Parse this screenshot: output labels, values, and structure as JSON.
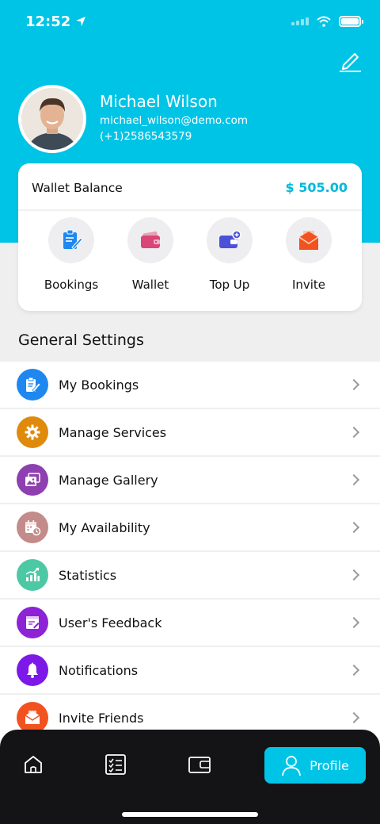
{
  "status_bar": {
    "time": "12:52"
  },
  "profile": {
    "name": "Michael Wilson",
    "email": "michael_wilson@demo.com",
    "phone": "(+1)2586543579"
  },
  "wallet": {
    "label": "Wallet Balance",
    "amount": "$ 505.00"
  },
  "quick_actions": [
    {
      "label": "Bookings",
      "icon": "clipboard-edit-icon"
    },
    {
      "label": "Wallet",
      "icon": "wallet-icon"
    },
    {
      "label": "Top Up",
      "icon": "wallet-plus-icon"
    },
    {
      "label": "Invite",
      "icon": "envelope-icon"
    }
  ],
  "settings": {
    "title": "General Settings",
    "items": [
      {
        "label": "My Bookings",
        "icon": "clipboard-edit-icon",
        "color": "#1e88f0"
      },
      {
        "label": "Manage Services",
        "icon": "gear-icon",
        "color": "#e08a0b"
      },
      {
        "label": "Manage Gallery",
        "icon": "gallery-icon",
        "color": "#8e3fb0"
      },
      {
        "label": "My Availability",
        "icon": "calendar-clock-icon",
        "color": "#c48b8b"
      },
      {
        "label": "Statistics",
        "icon": "bar-chart-icon",
        "color": "#4cc9a4"
      },
      {
        "label": "User's Feedback",
        "icon": "feedback-icon",
        "color": "#8d22d6"
      },
      {
        "label": "Notifications",
        "icon": "bell-icon",
        "color": "#7c18e8"
      },
      {
        "label": "Invite Friends",
        "icon": "envelope-icon",
        "color": "#f2521f"
      }
    ]
  },
  "tabbar": {
    "tabs": [
      {
        "name": "home",
        "icon": "home-icon"
      },
      {
        "name": "checklist",
        "icon": "checklist-icon"
      },
      {
        "name": "wallet",
        "icon": "wallet-icon"
      }
    ],
    "active_label": "Profile",
    "active_icon": "user-icon"
  },
  "colors": {
    "accent": "#00c4e6",
    "amount": "#00b9db"
  }
}
